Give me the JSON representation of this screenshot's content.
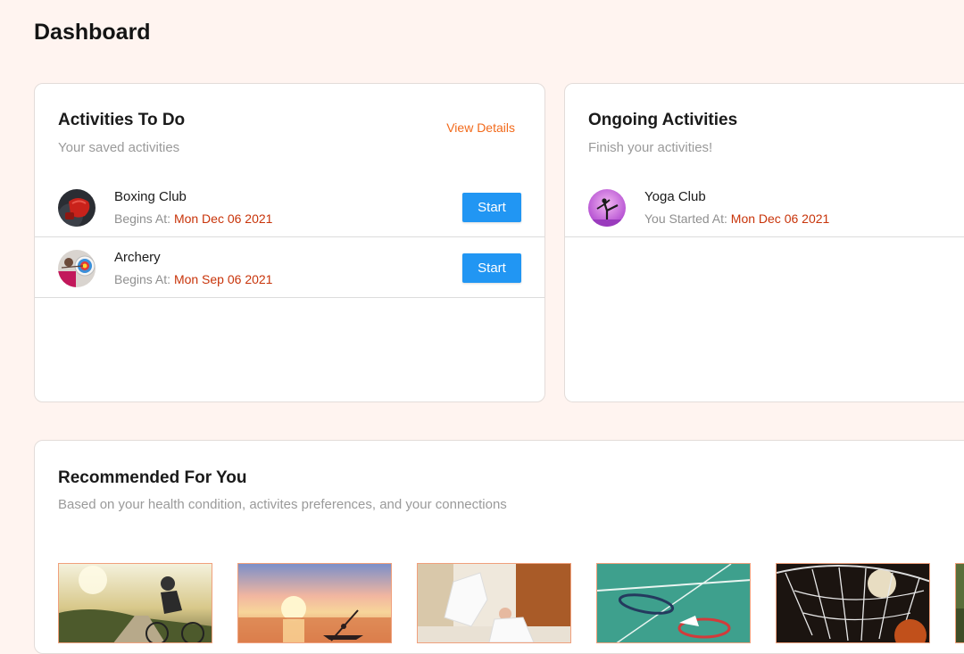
{
  "page": {
    "title": "Dashboard"
  },
  "todo": {
    "title": "Activities To Do",
    "subtitle": "Your saved activities",
    "view_details": "View Details",
    "items": [
      {
        "name": "Boxing Club",
        "meta_label": "Begins At:",
        "date": "Mon Dec 06 2021",
        "action": "Start",
        "icon": "boxing-glove-icon"
      },
      {
        "name": "Archery",
        "meta_label": "Begins At:",
        "date": "Mon Sep 06 2021",
        "action": "Start",
        "icon": "archery-target-icon"
      }
    ]
  },
  "ongoing": {
    "title": "Ongoing Activities",
    "subtitle": "Finish your activities!",
    "items": [
      {
        "name": "Yoga Club",
        "meta_label": "You Started At:",
        "date": "Mon Dec 06 2021",
        "icon": "yoga-pose-icon"
      }
    ]
  },
  "recommended": {
    "title": "Recommended For You",
    "subtitle": "Based on your health condition, activites preferences, and your connections",
    "thumbnails": [
      "cycling-image",
      "kayaking-sunset-image",
      "judo-image",
      "badminton-image",
      "basketball-hoop-image",
      "outdoor-image"
    ]
  },
  "colors": {
    "background": "#fff4f0",
    "accent_link": "#f26a1b",
    "date_text": "#c8340a",
    "button": "#2196f3"
  }
}
